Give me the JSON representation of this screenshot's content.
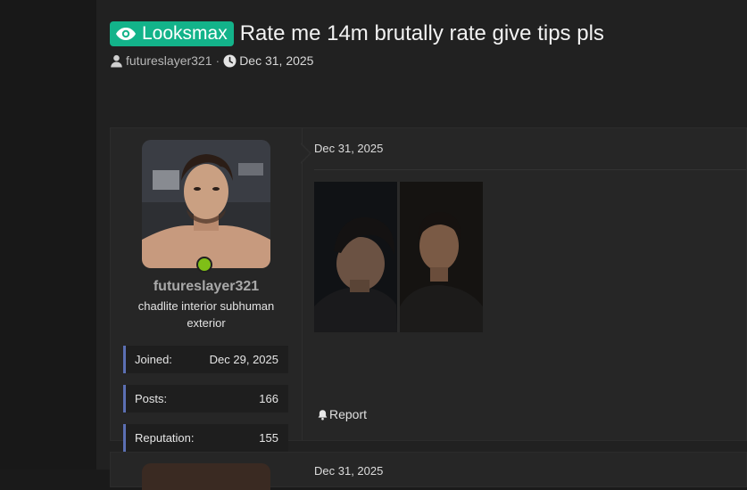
{
  "thread": {
    "prefix": "Looksmax",
    "prefix_color": "#13b38a",
    "prefix_icon": "eye-icon",
    "title": "Rate me 14m brutally rate give tips pls",
    "author": "futureslayer321",
    "date": "Dec 31, 2025",
    "meta_separator": "·"
  },
  "post": {
    "date": "Dec 31, 2025",
    "report_label": "Report",
    "user": {
      "username": "futureslayer321",
      "user_title": "chadlite interior subhuman exterior",
      "online_color": "#7fbf17",
      "stats": [
        {
          "label": "Joined:",
          "value": "Dec 29, 2025"
        },
        {
          "label": "Posts:",
          "value": "166"
        },
        {
          "label": "Reputation:",
          "value": "155"
        }
      ]
    }
  },
  "post2": {
    "date": "Dec 31, 2025"
  }
}
